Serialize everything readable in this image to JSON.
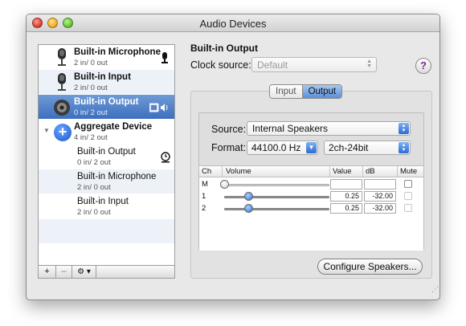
{
  "window": {
    "title": "Audio Devices"
  },
  "devices": [
    {
      "name": "Built-in Microphone",
      "io": "2 in/ 0 out",
      "icon": "microphone-icon",
      "right_icon": "mic-input-icon"
    },
    {
      "name": "Built-in Input",
      "io": "2 in/ 0 out",
      "icon": "microphone-icon"
    },
    {
      "name": "Built-in Output",
      "io": "0 in/ 2 out",
      "icon": "speaker-icon",
      "right_icon": "finder-speaker-icon"
    },
    {
      "name": "Aggregate Device",
      "io": "4 in/ 2 out",
      "icon": "aggregate-plus-icon"
    }
  ],
  "subdevices": [
    {
      "name": "Built-in Output",
      "io": "0 in/ 2 out",
      "right_icon": "clock-icon"
    },
    {
      "name": "Built-in Microphone",
      "io": "2 in/ 0 out"
    },
    {
      "name": "Built-in Input",
      "io": "2 in/ 0 out"
    }
  ],
  "toolbar": {
    "add": "+",
    "remove": "–",
    "gear": "⚙ ▾"
  },
  "detail": {
    "title": "Built-in Output",
    "clock_label": "Clock source:",
    "clock_value": "Default",
    "help": "?"
  },
  "tabs": {
    "input": "Input",
    "output": "Output"
  },
  "output": {
    "source_label": "Source:",
    "source_value": "Internal Speakers",
    "format_label": "Format:",
    "format_rate": "44100.0 Hz",
    "format_bits": "2ch-24bit"
  },
  "table": {
    "headers": [
      "Ch",
      "Volume",
      "Value",
      "dB",
      "Mute"
    ],
    "rows": [
      {
        "ch": "M",
        "value": "",
        "db": "",
        "volume": 0.0
      },
      {
        "ch": "1",
        "value": "0.25",
        "db": "-32.00",
        "volume": 0.25
      },
      {
        "ch": "2",
        "value": "0.25",
        "db": "-32.00",
        "volume": 0.25
      }
    ]
  },
  "configure_label": "Configure Speakers..."
}
